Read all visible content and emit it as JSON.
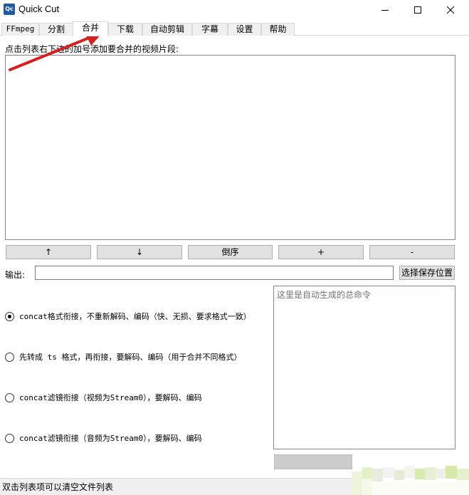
{
  "window": {
    "app_icon_text": "Qc",
    "title": "Quick Cut"
  },
  "tabs": [
    "FFmpeg",
    "分割",
    "合并",
    "下载",
    "自动剪辑",
    "字幕",
    "设置",
    "帮助"
  ],
  "active_tab": "合并",
  "merge": {
    "hint": "点击列表右下边的加号添加要合并的视频片段:",
    "buttons": {
      "up": "↑",
      "down": "↓",
      "reverse": "倒序",
      "add": "+",
      "remove": "-"
    },
    "output_label": "输出:",
    "output_value": "",
    "choose_location": "选择保存位置",
    "command_placeholder": "这里是自动生成的总命令",
    "options": [
      {
        "label": "concat格式衔接，不重新解码、编码（快、无损、要求格式一致）",
        "checked": true
      },
      {
        "label": "先转成 ts 格式，再衔接，要解码、编码（用于合并不同格式）",
        "checked": false
      },
      {
        "label": "concat滤镜衔接（视频为Stream0），要解码、编码",
        "checked": false
      },
      {
        "label": "concat滤镜衔接（音频为Stream0），要解码、编码",
        "checked": false
      }
    ],
    "run_label": ""
  },
  "statusbar": {
    "text": "双击列表项可以清空文件列表"
  },
  "colors": {
    "annotation_arrow": "#d42020",
    "button_face": "#e1e1e1",
    "tab_inactive": "#f0f0f0"
  }
}
